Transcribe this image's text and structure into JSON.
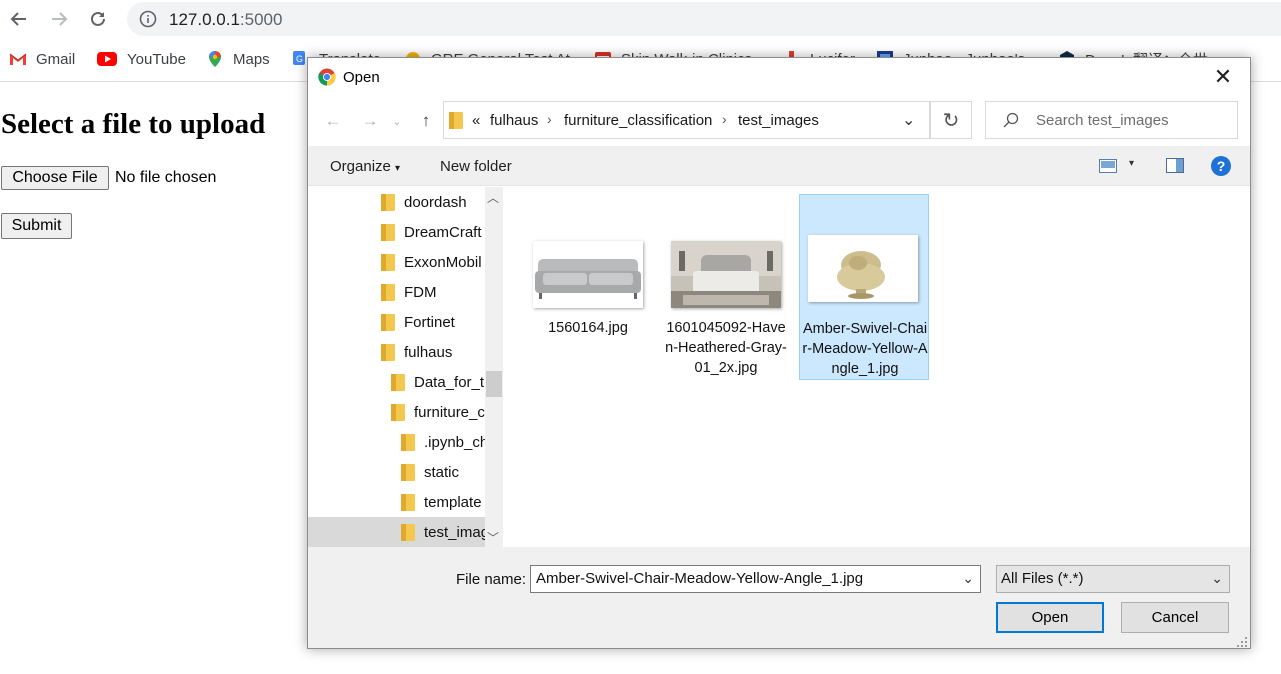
{
  "browser": {
    "url_host": "127.0.0.1",
    "url_port": ":5000",
    "bookmarks": [
      {
        "label": "Gmail",
        "icon": "gmail-icon"
      },
      {
        "label": "YouTube",
        "icon": "youtube-icon"
      },
      {
        "label": "Maps",
        "icon": "maps-icon"
      },
      {
        "label": "Translate",
        "icon": "translate-icon"
      },
      {
        "label": "GRE General Test At...",
        "icon": "bookmark-icon"
      },
      {
        "label": "Skin Walk-in Clinics...",
        "icon": "bookmark-icon"
      },
      {
        "label": "Lucifer",
        "icon": "bookmark-icon"
      },
      {
        "label": "Junhao - Junhao's...",
        "icon": "bookmark-icon"
      },
      {
        "label": "DeepL 翻译：全世...",
        "icon": "deepl-icon"
      }
    ]
  },
  "page": {
    "heading": "Select a file to upload",
    "choose_file_label": "Choose File",
    "no_file_text": "No file chosen",
    "submit_label": "Submit"
  },
  "dialog": {
    "title": "Open",
    "breadcrumb": {
      "overflow": "«",
      "items": [
        "fulhaus",
        "furniture_classification",
        "test_images"
      ]
    },
    "search_placeholder": "Search test_images",
    "toolbar": {
      "organize_label": "Organize",
      "new_folder_label": "New folder"
    },
    "tree": [
      {
        "label": "doordash",
        "level": 1
      },
      {
        "label": "DreamCraft",
        "level": 1
      },
      {
        "label": "ExxonMobil",
        "level": 1
      },
      {
        "label": "FDM",
        "level": 1
      },
      {
        "label": "Fortinet",
        "level": 1
      },
      {
        "label": "fulhaus",
        "level": 1
      },
      {
        "label": "Data_for_t",
        "level": 2
      },
      {
        "label": "furniture_c",
        "level": 2
      },
      {
        "label": ".ipynb_ch",
        "level": 3
      },
      {
        "label": "static",
        "level": 3
      },
      {
        "label": "template",
        "level": 3
      },
      {
        "label": "test_imag",
        "level": 3,
        "selected": true
      }
    ],
    "files": [
      {
        "name": "1560164.jpg",
        "thumb": "sofa"
      },
      {
        "name": "1601045092-Haven-Heathered-Gray-01_2x.jpg",
        "thumb": "bed"
      },
      {
        "name": "Amber-Swivel-Chair-Meadow-Yellow-Angle_1.jpg",
        "thumb": "chair",
        "selected": true
      }
    ],
    "file_name_label": "File name:",
    "file_name_value": "Amber-Swivel-Chair-Meadow-Yellow-Angle_1.jpg",
    "file_type_value": "All Files (*.*)",
    "open_label": "Open",
    "cancel_label": "Cancel"
  },
  "colors": {
    "accent": "#0078d7",
    "selection_bg": "#cce8ff",
    "folder_yellow": "#f4c74f"
  }
}
